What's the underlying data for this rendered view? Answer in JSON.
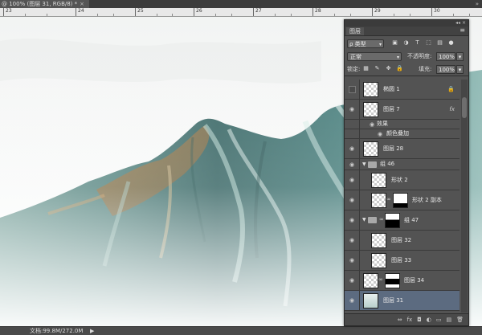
{
  "tab": {
    "title": "@ 100% (图层 31, RGB/8) *",
    "close": "×",
    "more": "»"
  },
  "ruler": {
    "ticks": [
      "23",
      "24",
      "25",
      "26",
      "27",
      "28",
      "29",
      "30"
    ]
  },
  "status": {
    "doc_size": "文档:99.8M/272.0M",
    "arrow": "▶"
  },
  "panel": {
    "collapse": "◂◂ ×",
    "tab_label": "图层",
    "menu": "≡",
    "filter_kind": "ρ 类型",
    "filter_icons": [
      "image-filter-icon",
      "adjustment-filter-icon",
      "type-filter-icon",
      "shape-filter-icon",
      "smartobject-filter-icon",
      "filter-toggle-icon"
    ],
    "blend_mode": "正常",
    "opacity_label": "不透明度:",
    "opacity_value": "100%",
    "lock_label": "锁定:",
    "fill_label": "填充:",
    "fill_value": "100%",
    "layers": [
      {
        "name": "椭圆 1",
        "visible": false,
        "locked": true
      },
      {
        "name": "图层 7",
        "visible": true,
        "fx": "fx"
      },
      {
        "name": "效果",
        "effect": true
      },
      {
        "name": "颜色叠加",
        "effect": true
      },
      {
        "name": "图层 28",
        "visible": true
      },
      {
        "name": "组 46",
        "visible": true,
        "group": true
      },
      {
        "name": "形状 2",
        "visible": true
      },
      {
        "name": "形状 2 副本",
        "visible": true,
        "masked": true
      },
      {
        "name": "组 47",
        "visible": true,
        "group": true,
        "masked": true
      },
      {
        "name": "图层 32",
        "visible": true
      },
      {
        "name": "图层 33",
        "visible": true
      },
      {
        "name": "图层 34",
        "visible": true,
        "masked": true
      },
      {
        "name": "图层 31",
        "visible": true,
        "selected": true
      }
    ],
    "bottom_icons": [
      "link-icon",
      "fx-icon",
      "add-mask-icon",
      "adjustment-layer-icon",
      "new-group-icon",
      "new-layer-icon",
      "trash-icon"
    ],
    "bottom_labels": [
      "⇔",
      "fx",
      "◘",
      "◐",
      "▭",
      "▤",
      "🗑"
    ]
  }
}
